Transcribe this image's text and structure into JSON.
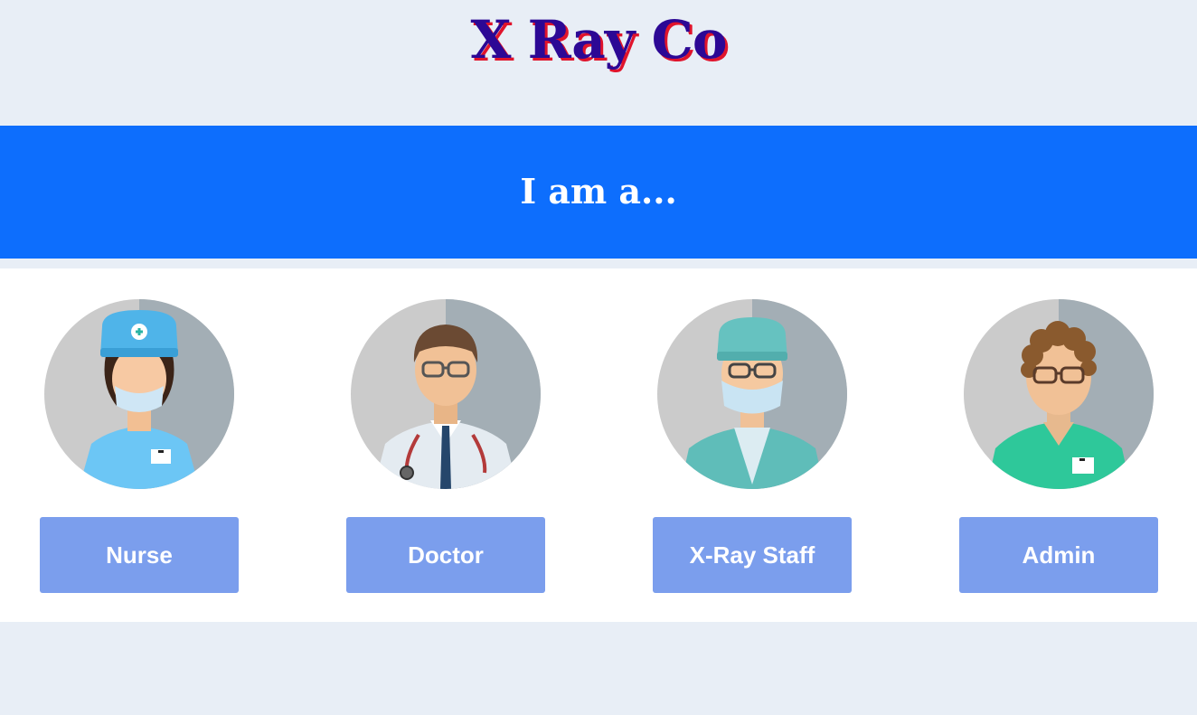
{
  "site": {
    "title": "X Ray Co"
  },
  "banner": {
    "heading": "I am a..."
  },
  "roles": [
    {
      "label": "Nurse",
      "icon": "nurse-avatar-icon"
    },
    {
      "label": "Doctor",
      "icon": "doctor-avatar-icon"
    },
    {
      "label": "X-Ray Staff",
      "icon": "xray-staff-avatar-icon"
    },
    {
      "label": "Admin",
      "icon": "admin-avatar-icon"
    }
  ],
  "colors": {
    "page_background": "#e8eef6",
    "title_text": "#2c0895",
    "title_shadow": "#e0142c",
    "banner_background": "#0d6efd",
    "button_background": "#7b9eed",
    "button_text": "#ffffff"
  }
}
